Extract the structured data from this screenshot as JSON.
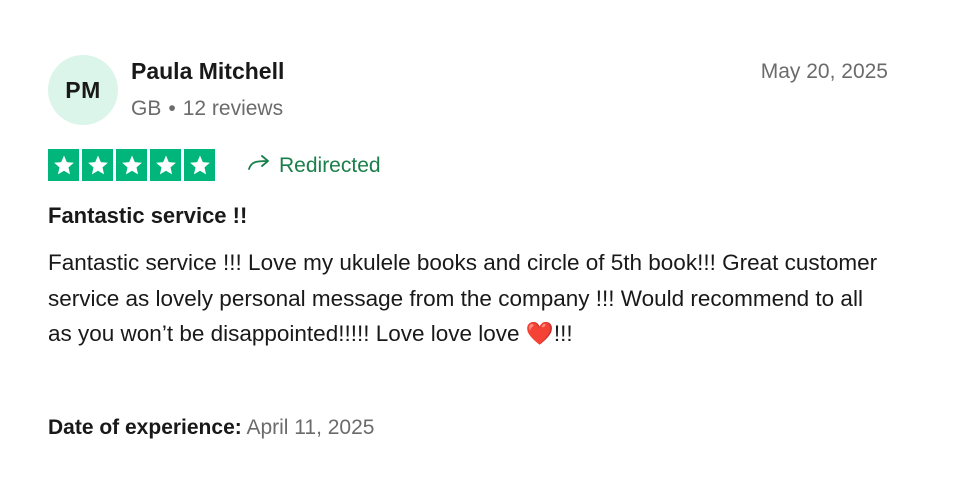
{
  "reviewer": {
    "initials": "PM",
    "name": "Paula Mitchell",
    "country": "GB",
    "separator": "•",
    "review_count": "12 reviews"
  },
  "review": {
    "date": "May 20, 2025",
    "rating": 5,
    "rating_max": 5,
    "star_color": "#00b67a",
    "source_label": "Redirected",
    "source_icon": "redirect-arrow-icon",
    "title": "Fantastic service !!",
    "body": "Fantastic service !!! Love my ukulele books and circle of 5th book!!! Great customer service as lovely personal message from the company !!! Would recommend to all as you won’t be disappointed!!!!! Love love love ❤️!!!",
    "experience_label": "Date of experience:",
    "experience_date": "April 11, 2025"
  }
}
